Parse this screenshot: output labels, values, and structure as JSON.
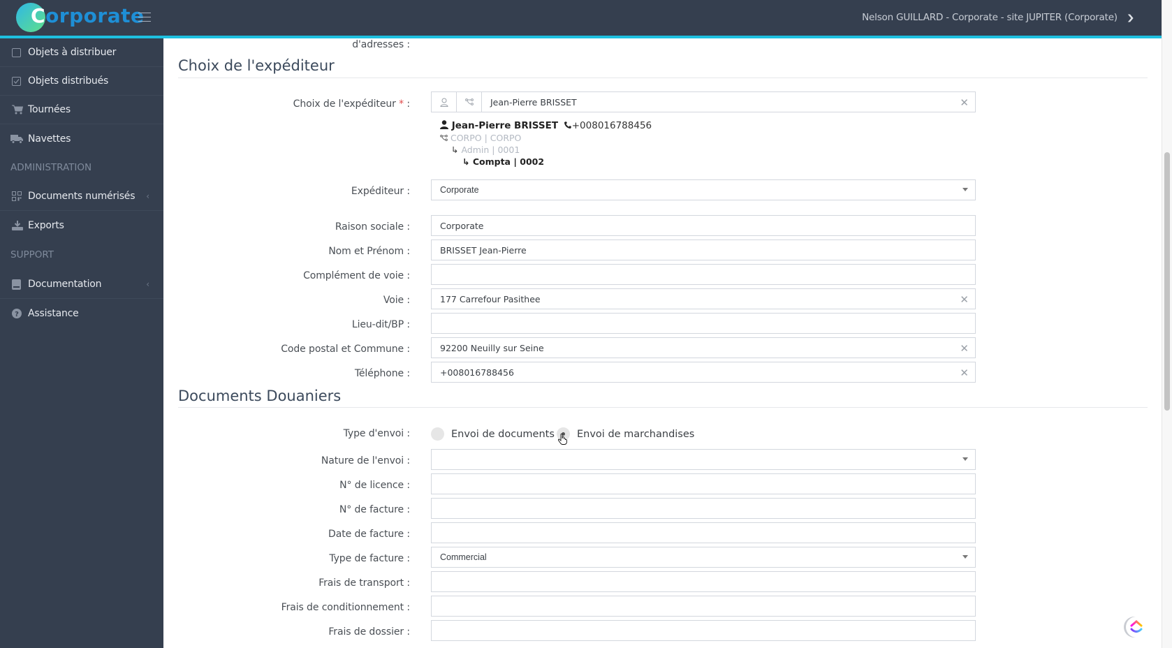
{
  "header": {
    "brand_first_letter": "C",
    "brand_rest": "orporate",
    "user_menu_label": "Nelson GUILLARD - Corporate - site JUPITER (Corporate)",
    "accent_color": "#1ec0e0",
    "brand_color": "#1e8fd6"
  },
  "sidebar": {
    "items": [
      {
        "label": "Objets à distribuer",
        "icon": "square-icon"
      },
      {
        "label": "Objets distribués",
        "icon": "check-square-icon"
      },
      {
        "label": "Tournées",
        "icon": "cart-icon"
      },
      {
        "label": "Navettes",
        "icon": "truck-icon"
      }
    ],
    "section_admin": "ADMINISTRATION",
    "admin_items": [
      {
        "label": "Documents numérisés",
        "icon": "qrcode-icon",
        "has_submenu": true
      },
      {
        "label": "Exports",
        "icon": "download-icon"
      }
    ],
    "section_support": "SUPPORT",
    "support_items": [
      {
        "label": "Documentation",
        "icon": "book-icon",
        "has_submenu": true
      },
      {
        "label": "Assistance",
        "icon": "question-circle-icon"
      }
    ]
  },
  "form": {
    "top_partial_label": "d'adresses :",
    "sender_section": {
      "title": "Choix de l'expéditeur",
      "choice_label": "Choix de l'expéditeur",
      "required_mark": "*",
      "choice_suffix": " :",
      "choice_value": "Jean-Pierre BRISSET",
      "card": {
        "name": "Jean-Pierre BRISSET",
        "phone": "+008016788456",
        "org_level1": "CORPO | CORPO",
        "org_level2": "Admin | 0001",
        "org_level3": "Compta | 0002"
      },
      "expediteur_label": "Expéditeur :",
      "expediteur_value": "Corporate",
      "raison_sociale_label": "Raison sociale :",
      "raison_sociale_value": "Corporate",
      "nom_prenom_label": "Nom et Prénom :",
      "nom_prenom_value": "BRISSET Jean-Pierre",
      "complement_label": "Complément de voie :",
      "complement_value": "",
      "voie_label": "Voie :",
      "voie_value": "177 Carrefour Pasithee",
      "lieu_dit_label": "Lieu-dit/BP :",
      "lieu_dit_value": "",
      "cp_commune_label": "Code postal et Commune :",
      "cp_commune_value": "92200 Neuilly sur Seine",
      "telephone_label": "Téléphone :",
      "telephone_value": "+008016788456"
    },
    "customs_section": {
      "title": "Documents Douaniers",
      "type_envoi_label": "Type d'envoi :",
      "type_envoi_options": [
        "Envoi de documents",
        "Envoi de marchandises"
      ],
      "type_envoi_selected": "Envoi de marchandises",
      "nature_label": "Nature de l'envoi :",
      "nature_value": "",
      "licence_label": "N° de licence :",
      "licence_value": "",
      "facture_no_label": "N° de facture :",
      "facture_no_value": "",
      "date_facture_label": "Date de facture :",
      "date_facture_value": "",
      "type_facture_label": "Type de facture :",
      "type_facture_value": "Commercial",
      "frais_transport_label": "Frais de transport :",
      "frais_transport_value": "",
      "frais_conditionnement_label": "Frais de conditionnement :",
      "frais_conditionnement_value": "",
      "frais_dossier_label": "Frais de dossier :",
      "frais_dossier_value": ""
    }
  }
}
